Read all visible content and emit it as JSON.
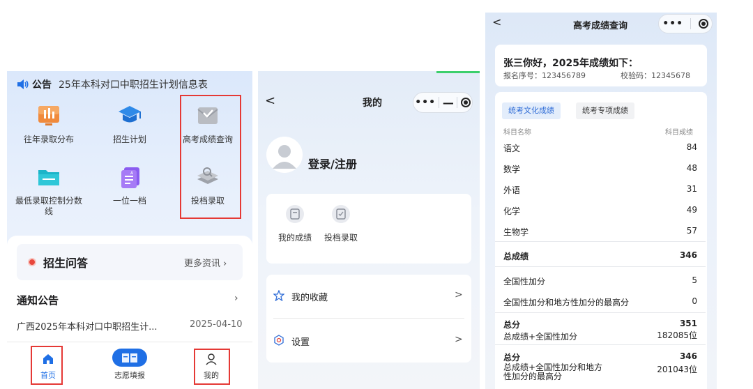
{
  "panel1": {
    "notice_label": "公告",
    "notice_text": "25年本科对口中职招生计划信息表",
    "grid": [
      {
        "label": "往年录取分布",
        "icon": "bar-chart-icon"
      },
      {
        "label": "招生计划",
        "icon": "graduation-cap-icon"
      },
      {
        "label": "高考成绩查询",
        "icon": "envelope-check-icon"
      },
      {
        "label": "最低录取控制分数线",
        "icon": "folder-icon"
      },
      {
        "label": "一位一档",
        "icon": "document-ai-icon"
      },
      {
        "label": "投档录取",
        "icon": "layers-search-icon"
      }
    ],
    "qa_title": "招生问答",
    "qa_more": "更多资讯",
    "notice_section_title": "通知公告",
    "news_title": "广西2025年本科对口中职招生计...",
    "news_date": "2025-04-10",
    "tabs": [
      {
        "label": "首页",
        "active": true
      },
      {
        "label": "志愿填报",
        "active": false
      },
      {
        "label": "我的",
        "active": false
      }
    ],
    "active_color": "#1f6fe5"
  },
  "panel2": {
    "nav_back": "<",
    "nav_title": "我的",
    "capsule_dots": "•••",
    "login_text": "登录/注册",
    "quick": [
      {
        "label": "我的成绩",
        "icon": "score-icon"
      },
      {
        "label": "投档录取",
        "icon": "admission-icon"
      }
    ],
    "rows": [
      {
        "label": "我的收藏",
        "icon": "star-icon",
        "chevron": ">"
      },
      {
        "label": "设置",
        "icon": "settings-icon",
        "chevron": ">"
      }
    ]
  },
  "panel3": {
    "nav_back": "<",
    "nav_title": "高考成绩查询",
    "capsule_dots": "•••",
    "greeting": "张三你好，2025年成绩如下：",
    "reg_no": "报名序号：123456789",
    "check_code": "校验码：12345678",
    "tabs": [
      "统考文化成绩",
      "统考专项成绩"
    ],
    "col_subject": "科目名称",
    "col_score": "科目成绩",
    "subjects": [
      {
        "name": "语文",
        "score": "84"
      },
      {
        "name": "数学",
        "score": "48"
      },
      {
        "name": "外语",
        "score": "31"
      },
      {
        "name": "化学",
        "score": "49"
      },
      {
        "name": "生物学",
        "score": "57"
      }
    ],
    "total_label": "总成绩",
    "total_value": "346",
    "bonus_national_label": "全国性加分",
    "bonus_national_value": "5",
    "bonus_max_label": "全国性加分和地方性加分的最高分",
    "bonus_max_value": "0",
    "sum1_label": "总分",
    "sum1_sub": "总成绩+全国性加分",
    "sum1_value": "351",
    "sum1_rank": "182085位",
    "sum2_label": "总分",
    "sum2_sub_line1": "总成绩+全国性加分和地方",
    "sum2_sub_line2": "性加分的最高分",
    "sum2_value": "346",
    "sum2_rank": "201043位"
  }
}
